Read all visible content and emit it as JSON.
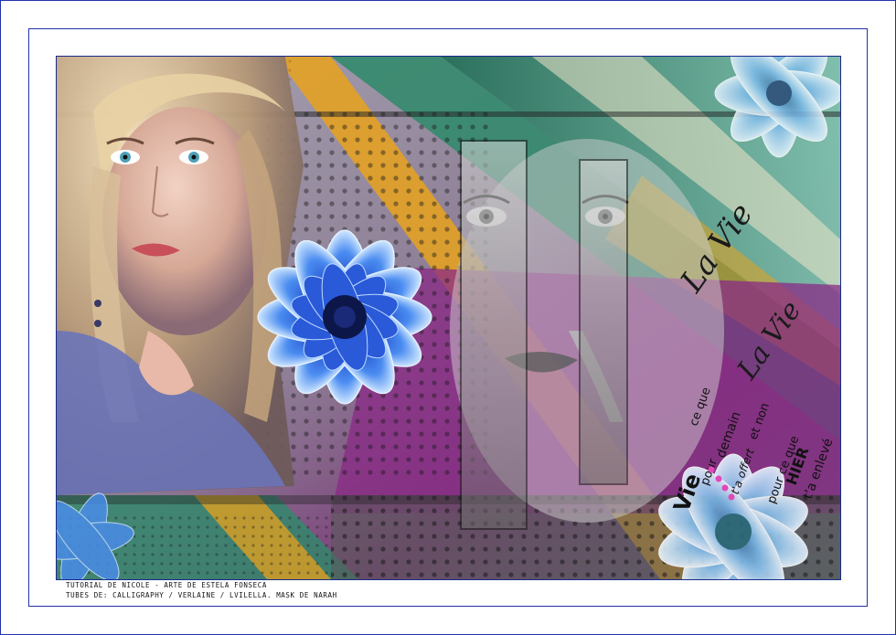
{
  "frame": {
    "border_color": "#2233aa"
  },
  "artwork": {
    "subject": "digital collage: blonde woman portrait, blue chrysanthemums, close-up face strips, calligraphy text",
    "colors": [
      "#2e8a6a",
      "#e8a21c",
      "#8a2a86",
      "#3366dd",
      "#4a4a4a"
    ],
    "calligraphy_title": "La Vie",
    "calligraphy_repeat": "La Vie",
    "word_art": [
      "Vie",
      "pour",
      "ce que",
      "demain",
      "t'a offert",
      "et non",
      "pour ce que",
      "HIER",
      "t'a enlevé"
    ]
  },
  "credits": {
    "line1": "TUTORIAL DE NICOLE - ARTE DE ESTELA FONSECA",
    "line2": "TUBES DE: CALLIGRAPHY / VERLAINE / LVILELLA. MASK DE NARAH"
  }
}
